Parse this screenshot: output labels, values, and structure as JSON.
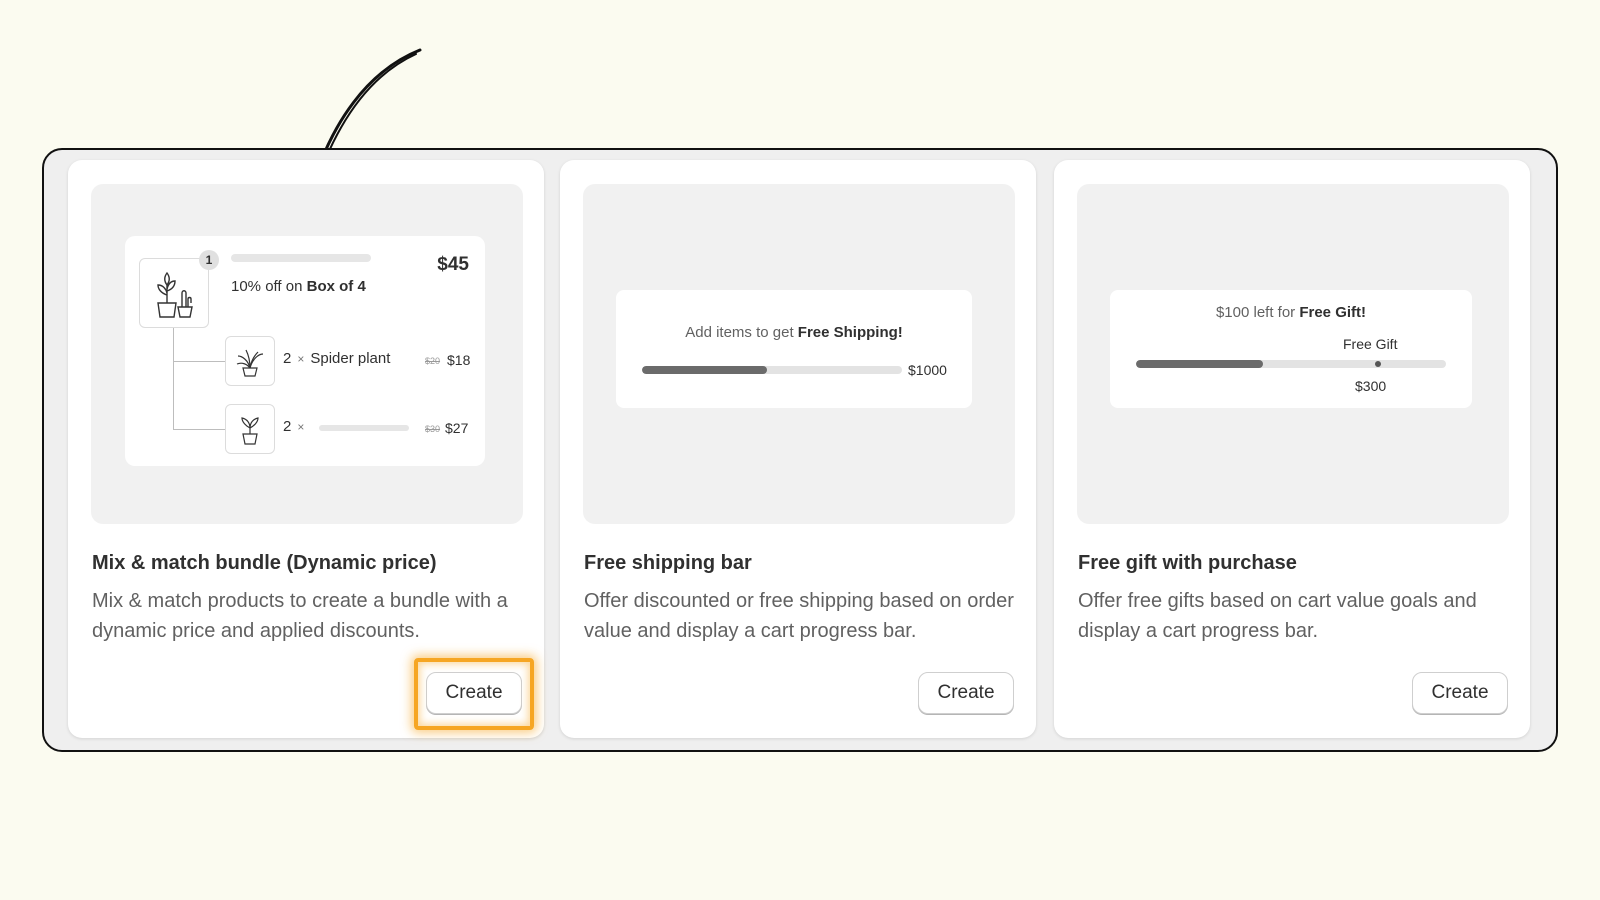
{
  "cards": [
    {
      "title": "Mix & match bundle (Dynamic price)",
      "description": "Mix & match products to create a bundle with a dynamic price and applied discounts.",
      "button": "Create",
      "preview": {
        "quantity_badge": "1",
        "discount_prefix": "10% off on ",
        "discount_item": "Box of 4",
        "total_price": "$45",
        "items": [
          {
            "qty": "2",
            "times": "×",
            "name": "Spider plant",
            "old_price": "$20",
            "price": "$18"
          },
          {
            "qty": "2",
            "times": "×",
            "name": "",
            "old_price": "$30",
            "price": "$27"
          }
        ]
      }
    },
    {
      "title": "Free shipping bar",
      "description": "Offer discounted or free shipping based on order value and display a cart progress bar.",
      "button": "Create",
      "preview": {
        "message_prefix": "Add items to get ",
        "message_bold": "Free Shipping!",
        "goal": "$1000",
        "progress": 0.48
      }
    },
    {
      "title": "Free gift with purchase",
      "description": "Offer free gifts based on cart value goals and display a cart progress bar.",
      "button": "Create",
      "preview": {
        "message_prefix": "$100 left for ",
        "message_bold": "Free Gift!",
        "milestone_label": "Free Gift",
        "milestone_value": "$300",
        "progress": 0.41,
        "milestone_position": 0.78
      }
    }
  ],
  "colors": {
    "page_bg": "#fbfbf0",
    "highlight": "#f6a623",
    "progress_fill": "#6b6b6b"
  },
  "annotations": {
    "arrow": "hand-drawn-arrow-icon",
    "highlight_target": "card-1-create-button"
  }
}
